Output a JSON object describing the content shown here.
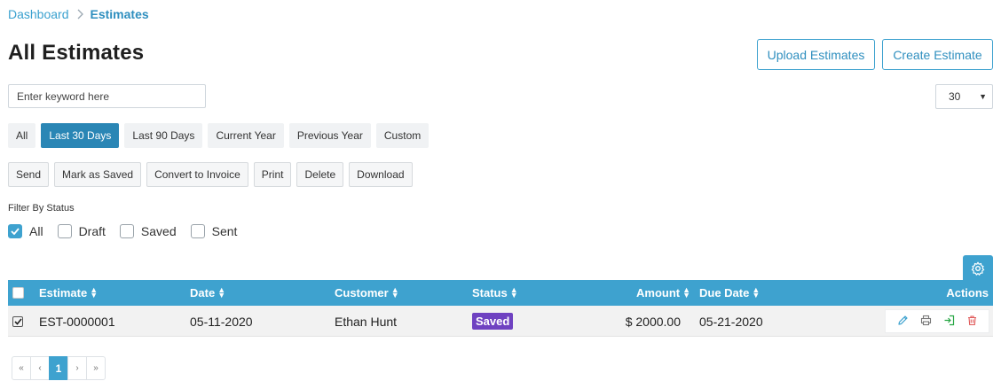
{
  "breadcrumb": {
    "home": "Dashboard",
    "current": "Estimates"
  },
  "page": {
    "title": "All Estimates"
  },
  "header_buttons": {
    "upload": "Upload Estimates",
    "create": "Create Estimate"
  },
  "search": {
    "placeholder": "Enter keyword here",
    "value": ""
  },
  "per_page": {
    "value": "30"
  },
  "date_filters": [
    "All",
    "Last 30 Days",
    "Last 90 Days",
    "Current Year",
    "Previous Year",
    "Custom"
  ],
  "active_date_filter": "Last 30 Days",
  "bulk_actions": [
    "Send",
    "Mark as Saved",
    "Convert to Invoice",
    "Print",
    "Delete",
    "Download"
  ],
  "status_filter": {
    "label": "Filter By Status",
    "options": [
      {
        "label": "All",
        "checked": true
      },
      {
        "label": "Draft",
        "checked": false
      },
      {
        "label": "Saved",
        "checked": false
      },
      {
        "label": "Sent",
        "checked": false
      }
    ]
  },
  "table": {
    "columns": {
      "estimate": "Estimate",
      "date": "Date",
      "customer": "Customer",
      "status": "Status",
      "amount": "Amount",
      "due_date": "Due Date",
      "actions": "Actions"
    },
    "rows": [
      {
        "checked": true,
        "estimate": "EST-0000001",
        "date": "05-11-2020",
        "customer": "Ethan Hunt",
        "status": "Saved",
        "amount": "$ 2000.00",
        "due_date": "05-21-2020"
      }
    ]
  },
  "row_action_icons": [
    "edit-icon",
    "print-icon",
    "convert-icon",
    "delete-icon"
  ],
  "pagination": {
    "first": "«",
    "prev": "‹",
    "current": "1",
    "next": "›",
    "last": "»"
  },
  "colors": {
    "primary": "#3ea2cf",
    "active_chip": "#2a86b5",
    "saved_badge": "#6f42c1",
    "edit": "#3ea2cf",
    "print": "#777777",
    "convert": "#28a745",
    "delete": "#e05a5a"
  }
}
